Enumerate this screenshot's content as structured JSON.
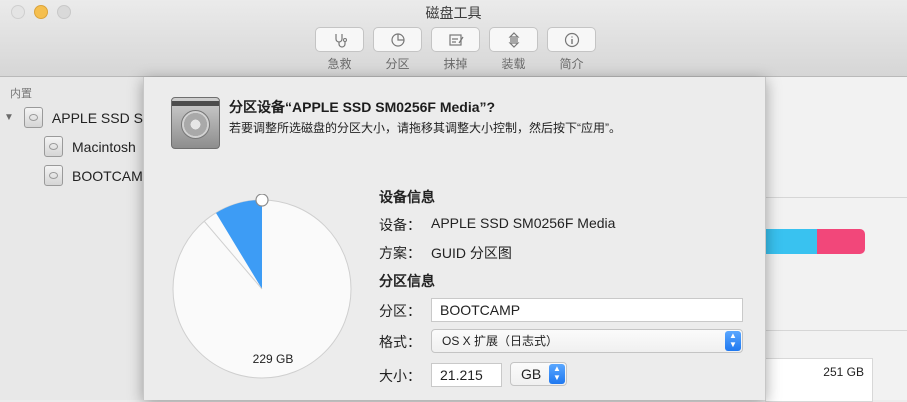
{
  "window": {
    "title": "磁盘工具"
  },
  "toolbar": {
    "items": [
      {
        "label": "急救",
        "icon": "stethoscope-icon"
      },
      {
        "label": "分区",
        "icon": "partition-icon"
      },
      {
        "label": "抹掉",
        "icon": "erase-icon"
      },
      {
        "label": "装载",
        "icon": "mount-icon"
      },
      {
        "label": "简介",
        "icon": "info-icon"
      }
    ]
  },
  "sidebar": {
    "section": "内置",
    "items": [
      {
        "label": "APPLE SSD S"
      },
      {
        "label": "Macintosh"
      },
      {
        "label": "BOOTCAM"
      }
    ]
  },
  "background": {
    "capacity_label": "251 GB",
    "colors": {
      "blue": "#39c2f0",
      "pink": "#f2477a"
    }
  },
  "dialog": {
    "title": "分区设备“APPLE SSD SM0256F Media”?",
    "subtitle": "若要调整所选磁盘的分区大小，请拖移其调整大小控制，然后按下“应用”。",
    "pie": {
      "main_label": "229 GB",
      "slice_color": "#3d9cf5",
      "main_fraction": 0.9
    },
    "device_info": {
      "heading": "设备信息",
      "device_label": "设备：",
      "device_value": "APPLE SSD SM0256F Media",
      "scheme_label": "方案：",
      "scheme_value": "GUID 分区图"
    },
    "partition_info": {
      "heading": "分区信息",
      "name_label": "分区：",
      "name_value": "BOOTCAMP",
      "format_label": "格式：",
      "format_value": "OS X 扩展（日志式）",
      "size_label": "大小：",
      "size_value": "21.215",
      "unit_value": "GB"
    }
  }
}
